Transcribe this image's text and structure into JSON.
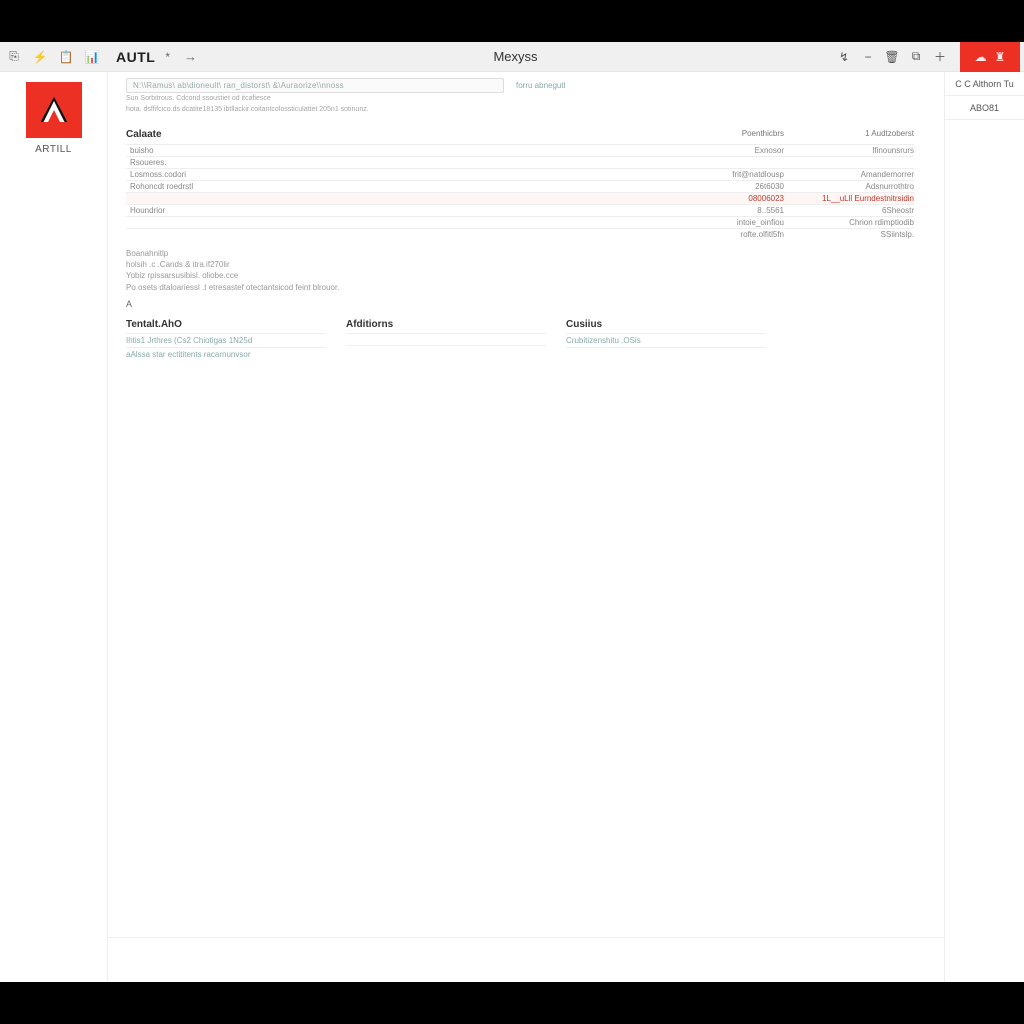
{
  "toolbar": {
    "app_name": "AUTL",
    "modified_marker": "*",
    "doc_title": "Mexyss",
    "icons": {
      "left": [
        "export-icon",
        "bolt-icon",
        "clipboard-icon",
        "chart-icon"
      ],
      "arrow": "→",
      "right": [
        "sync-icon",
        "minus-icon",
        "trash-icon",
        "copy-icon",
        "plus-icon"
      ],
      "redbox": [
        "cloud-icon",
        "user-icon"
      ]
    }
  },
  "sidebar": {
    "logo_label": "ARTILL"
  },
  "right_panel": {
    "tabs": [
      "C C Althorn Tu",
      "ABO81"
    ]
  },
  "info": {
    "path_text": "N:\\\\Ramus\\ ab\\dioneult\\ ran_distorst\\ &\\Auraorize\\\\nnoss",
    "info_label": "forru abnegutl",
    "meta1": "Sun Sorbitrous.   Cdcond ssoustiet od itcafiesce",
    "meta2": "hota.   dsffifcico.ds dcatite18135 ibtllackir.coitantcolossticulattet 205n1 sotinunz."
  },
  "panel": {
    "title": "Calaate",
    "col2_header": "Poenthicbrs",
    "col3_header": "1 Audtzoberst",
    "rows": [
      {
        "c1": "buisho",
        "c2": "Exnosor",
        "c3": "Ifinounsrurs"
      },
      {
        "c1": "Rsoueres.",
        "c2": "",
        "c3": ""
      },
      {
        "c1": "Losmoss.codori",
        "c2": "frit@natdlousp",
        "c3": "Amandemorrer"
      },
      {
        "c1": "Rohoncdt roedrstl",
        "c2": "26t6030",
        "c3": "Adsnurrothtro"
      },
      {
        "c1": "",
        "c2": "08006023",
        "c3": "1L__uLll Eurndestnitrsidin",
        "hl": true
      },
      {
        "c1": "Houndrior",
        "c2": "8..5561",
        "c3": "6Sheostr"
      },
      {
        "c1": "",
        "c2": "intoie_oinfiou",
        "c3": "Chrion rdimptiodib"
      },
      {
        "c1": "",
        "c2": "rofte.olfitl5fn",
        "c3": "SSiintslp."
      }
    ]
  },
  "textblock": {
    "lines": [
      "Boanahnitlp",
      "holsih .c .Cands & itra.if270lir",
      "Yobiz rpissarsusibisl. oliobe.cce",
      "Po osets dtaloariessl .t etresastef otectantsicod feint blrouor."
    ]
  },
  "marker_A": "A",
  "columns": [
    {
      "header": "Tentalt.AhO",
      "items": [
        "Ihtis1 Jrthres (Cs2 Chiotigas 1N25d",
        "aAlssa star ectititents racarnunvsor"
      ]
    },
    {
      "header": "Afditiorns",
      "items": [
        "",
        ""
      ]
    },
    {
      "header": "Cusiius",
      "items": [
        "Crubitizenshitu .OSis",
        ""
      ]
    }
  ]
}
